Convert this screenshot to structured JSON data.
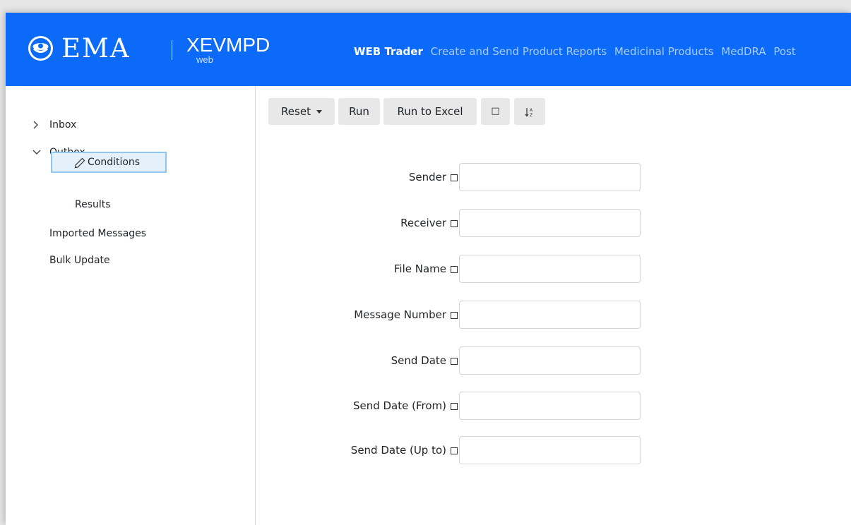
{
  "brand": {
    "logo_text": "EMA",
    "app_name": "XEVMPD",
    "app_suffix": "web",
    "colors": {
      "header_bg": "#0b6af7",
      "nav_inactive": "#a9ccff",
      "nav_active": "#ffffff"
    }
  },
  "nav": {
    "items": [
      {
        "label": "WEB Trader",
        "active": true
      },
      {
        "label": "Create and Send Product Reports",
        "active": false
      },
      {
        "label": "Medicinal Products",
        "active": false
      },
      {
        "label": "MedDRA",
        "active": false
      },
      {
        "label": "Post",
        "active": false
      }
    ]
  },
  "sidebar": {
    "items": [
      {
        "label": "Inbox",
        "icon": "chevron-right-icon",
        "expanded": false
      },
      {
        "label": "Outbox",
        "icon": "chevron-down-icon",
        "expanded": true
      },
      {
        "label": "Conditions",
        "icon": "pencil-icon",
        "selected": true
      },
      {
        "label": "Results"
      },
      {
        "label": "Imported Messages"
      },
      {
        "label": "Bulk Update"
      }
    ],
    "selected_color": "#e4f1fb"
  },
  "toolbar": {
    "reset_label": "Reset",
    "run_label": "Run",
    "run_excel_label": "Run to Excel",
    "square_label": "□",
    "sort_label": "↓⁂"
  },
  "form": {
    "fields": [
      {
        "label": "Sender",
        "value": "",
        "checked": false
      },
      {
        "label": "Receiver",
        "value": "",
        "checked": false
      },
      {
        "label": "File Name",
        "value": "",
        "checked": false
      },
      {
        "label": "Message Number",
        "value": "",
        "checked": false
      },
      {
        "label": "Send Date",
        "value": "",
        "checked": false
      },
      {
        "label": "Send Date (From)",
        "value": "",
        "checked": false
      },
      {
        "label": "Send Date (Up to)",
        "value": "",
        "checked": false
      }
    ]
  }
}
